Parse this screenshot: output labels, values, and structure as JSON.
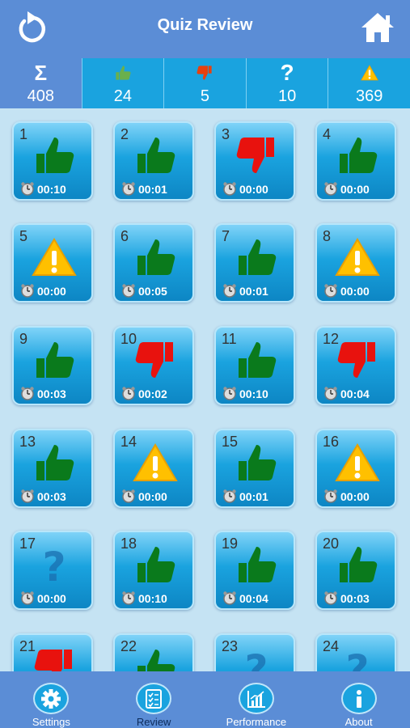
{
  "header": {
    "title": "Quiz Review"
  },
  "stats": [
    {
      "icon": "sigma-icon",
      "value": "408"
    },
    {
      "icon": "thumbs-up-icon",
      "value": "24"
    },
    {
      "icon": "thumbs-down-icon",
      "value": "5"
    },
    {
      "icon": "question-icon",
      "value": "10"
    },
    {
      "icon": "warning-icon",
      "value": "369"
    }
  ],
  "questions": [
    {
      "number": "1",
      "result": "correct",
      "time": "00:10"
    },
    {
      "number": "2",
      "result": "correct",
      "time": "00:01"
    },
    {
      "number": "3",
      "result": "wrong",
      "time": "00:00"
    },
    {
      "number": "4",
      "result": "correct",
      "time": "00:00"
    },
    {
      "number": "5",
      "result": "warning",
      "time": "00:00"
    },
    {
      "number": "6",
      "result": "correct",
      "time": "00:05"
    },
    {
      "number": "7",
      "result": "correct",
      "time": "00:01"
    },
    {
      "number": "8",
      "result": "warning",
      "time": "00:00"
    },
    {
      "number": "9",
      "result": "correct",
      "time": "00:03"
    },
    {
      "number": "10",
      "result": "wrong",
      "time": "00:02"
    },
    {
      "number": "11",
      "result": "correct",
      "time": "00:10"
    },
    {
      "number": "12",
      "result": "wrong",
      "time": "00:04"
    },
    {
      "number": "13",
      "result": "correct",
      "time": "00:03"
    },
    {
      "number": "14",
      "result": "warning",
      "time": "00:00"
    },
    {
      "number": "15",
      "result": "correct",
      "time": "00:01"
    },
    {
      "number": "16",
      "result": "warning",
      "time": "00:00"
    },
    {
      "number": "17",
      "result": "unanswered",
      "time": "00:00"
    },
    {
      "number": "18",
      "result": "correct",
      "time": "00:10"
    },
    {
      "number": "19",
      "result": "correct",
      "time": "00:04"
    },
    {
      "number": "20",
      "result": "correct",
      "time": "00:03"
    },
    {
      "number": "21",
      "result": "wrong",
      "time": ""
    },
    {
      "number": "22",
      "result": "correct",
      "time": ""
    },
    {
      "number": "23",
      "result": "unanswered",
      "time": ""
    },
    {
      "number": "24",
      "result": "unanswered",
      "time": ""
    }
  ],
  "tabs": [
    {
      "label": "Settings",
      "icon": "gear-icon"
    },
    {
      "label": "Review",
      "icon": "checklist-icon"
    },
    {
      "label": "Performance",
      "icon": "bar-chart-icon"
    },
    {
      "label": "About",
      "icon": "info-icon"
    }
  ],
  "colors": {
    "header": "#5b8dd6",
    "stats_bar": "#1aa3df",
    "background": "#c5e3f3",
    "correct": "#0a7a1c",
    "wrong": "#e8120e",
    "warning": "#ffc000",
    "unanswered": "#1a6fb0"
  }
}
